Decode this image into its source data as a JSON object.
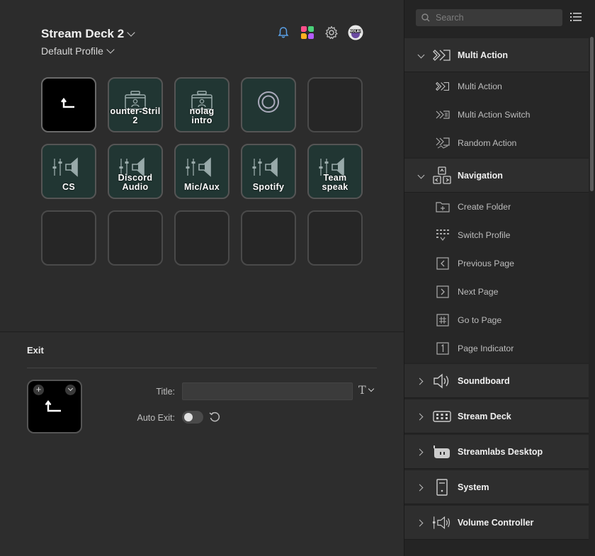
{
  "header": {
    "device_name": "Stream Deck 2",
    "profile_name": "Default Profile",
    "icons": [
      "bell-icon",
      "colorful-plugin-icon",
      "gear-icon",
      "nolag-avatar-icon"
    ]
  },
  "keys": [
    {
      "label": "",
      "icon": "back-arrow-icon",
      "style": "black"
    },
    {
      "label": "ounter-Stril\n2",
      "icon": "profile-switch-icon",
      "style": "teal"
    },
    {
      "label": "nolag\nintro",
      "icon": "profile-switch-icon",
      "style": "teal"
    },
    {
      "label": "",
      "icon": "circle-target-icon",
      "style": "teal"
    },
    {
      "label": "",
      "icon": "",
      "style": "empty"
    },
    {
      "label": "CS",
      "icon": "volume-mixer-icon",
      "style": "teal"
    },
    {
      "label": "Discord\nAudio",
      "icon": "volume-mixer-icon",
      "style": "teal"
    },
    {
      "label": "Mic/Aux",
      "icon": "volume-mixer-icon",
      "style": "teal"
    },
    {
      "label": "Spotify",
      "icon": "volume-mixer-icon",
      "style": "teal"
    },
    {
      "label": "Team\nspeak",
      "icon": "volume-mixer-icon",
      "style": "teal"
    },
    {
      "label": "",
      "icon": "",
      "style": "empty"
    },
    {
      "label": "",
      "icon": "",
      "style": "empty"
    },
    {
      "label": "",
      "icon": "",
      "style": "empty"
    },
    {
      "label": "",
      "icon": "",
      "style": "empty"
    },
    {
      "label": "",
      "icon": "",
      "style": "empty"
    }
  ],
  "inspector": {
    "title": "Exit",
    "plus_glyph": "+",
    "title_label": "Title:",
    "title_value": "",
    "t_glyph": "T",
    "auto_exit_label": "Auto Exit:",
    "auto_exit_on": false
  },
  "sidebar": {
    "search_placeholder": "Search",
    "categories": [
      {
        "label": "Multi Action",
        "expanded": true,
        "icon": "multi-action-icon",
        "items": [
          {
            "label": "Multi Action",
            "icon": "multi-action-icon"
          },
          {
            "label": "Multi Action Switch",
            "icon": "multi-action-switch-icon"
          },
          {
            "label": "Random Action",
            "icon": "random-action-icon"
          }
        ]
      },
      {
        "label": "Navigation",
        "expanded": true,
        "icon": "navigation-icon",
        "items": [
          {
            "label": "Create Folder",
            "icon": "folder-plus-icon"
          },
          {
            "label": "Switch Profile",
            "icon": "switch-profile-icon"
          },
          {
            "label": "Previous Page",
            "icon": "previous-page-icon"
          },
          {
            "label": "Next Page",
            "icon": "next-page-icon"
          },
          {
            "label": "Go to Page",
            "icon": "hash-icon"
          },
          {
            "label": "Page Indicator",
            "icon": "page-indicator-icon"
          }
        ]
      },
      {
        "label": "Soundboard",
        "expanded": false,
        "icon": "speaker-icon",
        "items": []
      },
      {
        "label": "Stream Deck",
        "expanded": false,
        "icon": "stream-deck-icon",
        "items": []
      },
      {
        "label": "Streamlabs Desktop",
        "expanded": false,
        "icon": "streamlabs-icon",
        "items": []
      },
      {
        "label": "System",
        "expanded": false,
        "icon": "system-tower-icon",
        "items": []
      },
      {
        "label": "Volume Controller",
        "expanded": false,
        "icon": "volume-controller-icon",
        "items": []
      }
    ],
    "page_indicator_digit": "1"
  },
  "colors": {
    "bell": "#5aa0e6",
    "key_teal_bg": "#213633",
    "background": "#2d2d2d",
    "sidebar_bg": "#242424"
  }
}
